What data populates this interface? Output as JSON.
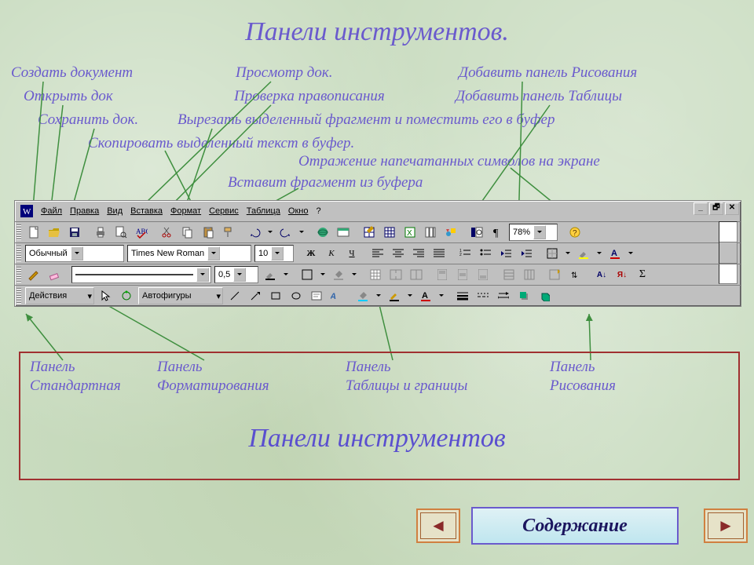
{
  "title": "Панели инструментов.",
  "annotations": {
    "create": "Создать документ",
    "open": "Открыть док",
    "save": "Сохранить док.",
    "copy": "Скопировать выделенный текст в буфер.",
    "preview": "Просмотр док.",
    "spell": "Проверка правописания",
    "cut": "Вырезать выделенный фрагмент и поместить его в буфер",
    "paste": "Вставит фрагмент из буфера",
    "echo": "Отражение напечатанных символов на экране",
    "draw_panel": "Добавить панель Рисования",
    "table_panel": "Добавить панель Таблицы"
  },
  "menu": {
    "file": "Файл",
    "edit": "Правка",
    "view": "Вид",
    "insert": "Вставка",
    "format": "Формат",
    "service": "Сервис",
    "table": "Таблица",
    "window": "Окно",
    "help": "?"
  },
  "toolbar": {
    "zoom": "78%",
    "style": "Обычный",
    "font": "Times New Roman",
    "size": "10",
    "bold": "Ж",
    "italic": "К",
    "underline": "Ч",
    "line_width": "0,5",
    "actions": "Действия",
    "autoshapes": "Автофигуры",
    "A": "А",
    "AZ_asc": "А↓",
    "AZ_desc": "Я↓",
    "sum": "Σ"
  },
  "panels": {
    "std_t": "Панель",
    "std_b": "Стандартная",
    "fmt_t": "Панель",
    "fmt_b": "Форматирования",
    "tbl_t": "Панель",
    "tbl_b": "Таблицы и границы",
    "drw_t": "Панель",
    "drw_b": "Рисования"
  },
  "big_label": "Панели инструментов",
  "nav": {
    "prev": "◄",
    "next": "►",
    "contents": "Содержание"
  }
}
